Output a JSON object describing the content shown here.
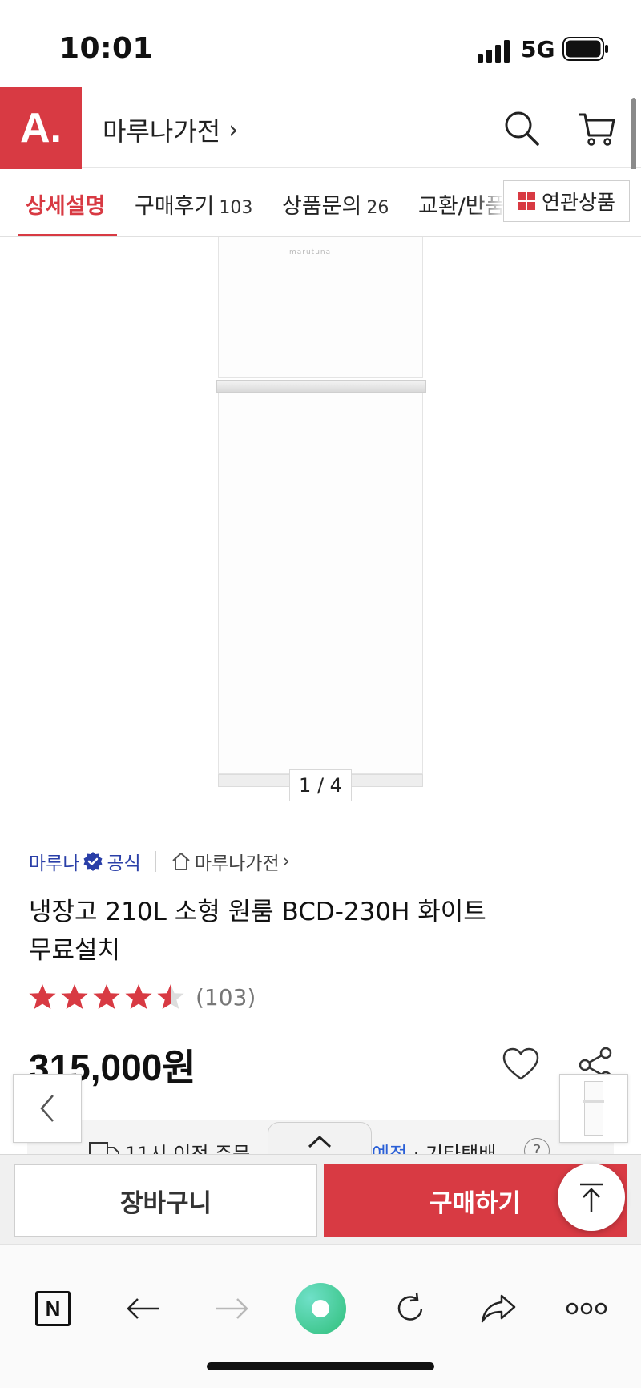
{
  "status_bar": {
    "time": "10:01",
    "network": "5G"
  },
  "header": {
    "logo_text": "A.",
    "store_name": "마루나가전",
    "store_chevron": "›"
  },
  "tabs": [
    {
      "label": "상세설명",
      "count": ""
    },
    {
      "label": "구매후기",
      "count": "103"
    },
    {
      "label": "상품문의",
      "count": "26"
    },
    {
      "label": "교환/반품",
      "count": ""
    }
  ],
  "related_button": {
    "label": "연관상품"
  },
  "gallery": {
    "brand_mark": "marutuna",
    "pager": "1 / 4"
  },
  "product": {
    "brand": "마루나",
    "official_label": "공식",
    "store_link": "마루나가전",
    "store_link_chevron": "›",
    "title_line1": "냉장고 210L 소형 원룸 BCD-230H 화이트",
    "title_line2": "무료설치",
    "rating": 4.5,
    "review_count": "(103)",
    "price": "315,000",
    "currency": "원"
  },
  "delivery": {
    "text_start": "11시 이전 주문",
    "text_blue": "예정",
    "text_end": " · 기타택배",
    "help": "?"
  },
  "actions": {
    "cart": "장바구니",
    "buy": "구매하기"
  },
  "colors": {
    "brand_red": "#d83a43",
    "brand_blue": "#2a3fa8",
    "star_red": "#d83a43"
  }
}
